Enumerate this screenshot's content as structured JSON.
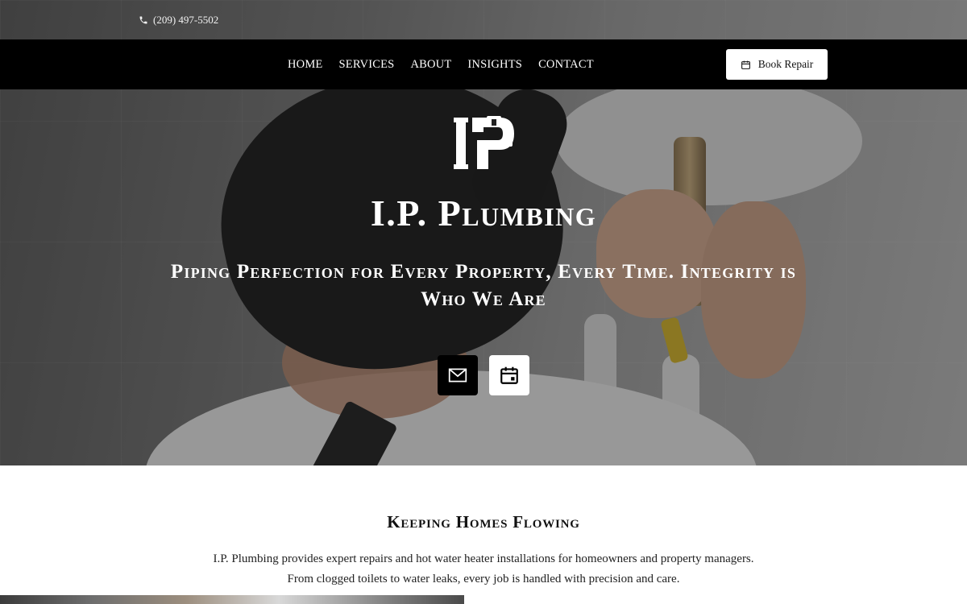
{
  "topbar": {
    "phone": "(209) 497-5502",
    "phone_icon": "phone-icon"
  },
  "nav": {
    "items": [
      {
        "label": "HOME"
      },
      {
        "label": "SERVICES"
      },
      {
        "label": "ABOUT"
      },
      {
        "label": "INSIGHTS"
      },
      {
        "label": "CONTACT"
      }
    ],
    "cta_label": "Book Repair",
    "cta_icon": "calendar-icon"
  },
  "hero": {
    "logo": "IP",
    "title": "I.P. Plumbing",
    "tagline": "Piping Perfection for Every Property, Every Time. Integrity is Who We Are",
    "buttons": [
      {
        "icon": "mail-icon"
      },
      {
        "icon": "calendar-icon"
      }
    ]
  },
  "intro": {
    "title": "Keeping Homes Flowing",
    "line1": "I.P. Plumbing provides expert repairs and hot water heater installations for homeowners and property managers.",
    "line2": "From clogged toilets to water leaks, every job is handled with precision and care."
  },
  "colors": {
    "nav_bg": "#000000",
    "text_light": "#ffffff",
    "accent_button": "#ffffff"
  }
}
